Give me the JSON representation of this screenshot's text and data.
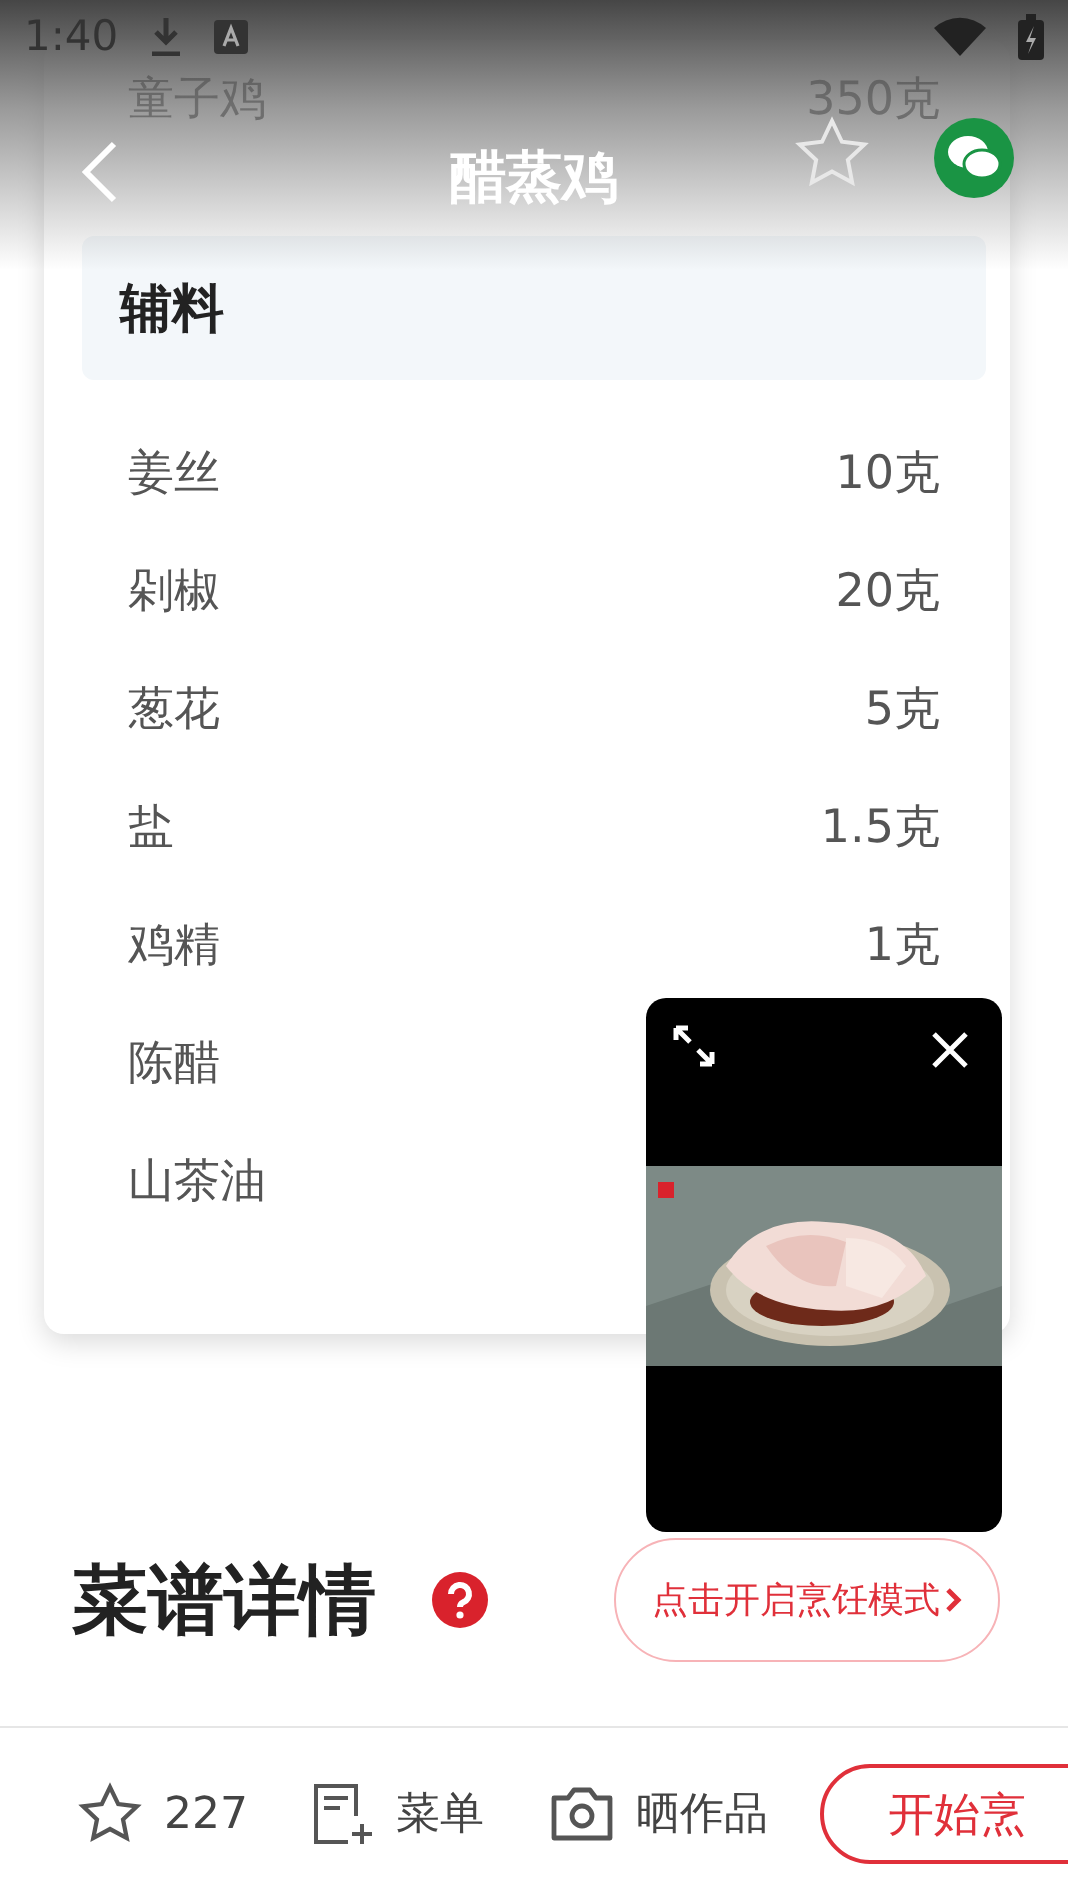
{
  "status_bar": {
    "time": "1:40"
  },
  "header": {
    "title": "醋蒸鸡",
    "favorited": false
  },
  "main_ingredient": {
    "name": "童子鸡",
    "amount": "350克"
  },
  "section": {
    "title": "辅料"
  },
  "ingredients": [
    {
      "name": "姜丝",
      "amount": "10克"
    },
    {
      "name": "剁椒",
      "amount": "20克"
    },
    {
      "name": "葱花",
      "amount": "5克"
    },
    {
      "name": "盐",
      "amount": "1.5克"
    },
    {
      "name": "鸡精",
      "amount": "1克"
    },
    {
      "name": "陈醋"
    },
    {
      "name": "山茶油"
    }
  ],
  "details": {
    "title": "菜谱详情",
    "mode_button": "点击开启烹饪模式"
  },
  "bottom_bar": {
    "favorites": "227",
    "menu": "菜单",
    "share": "晒作品",
    "start": "开始烹"
  }
}
